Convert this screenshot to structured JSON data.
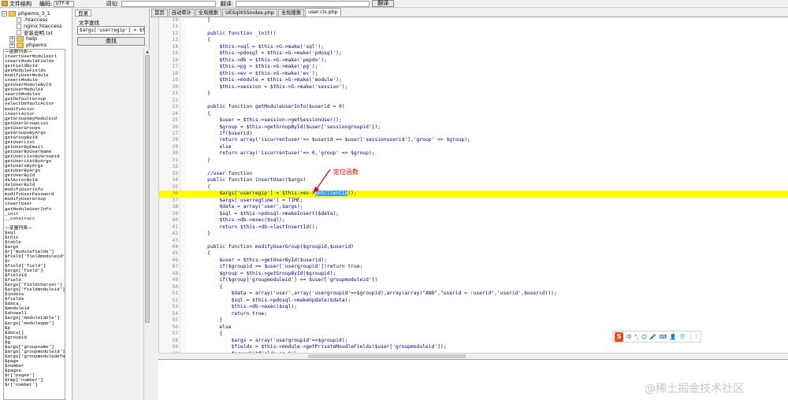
{
  "toolbar": {
    "structure_label": "文件结构",
    "encoding_label": "编码:",
    "encoding_value": "UTF-8",
    "word_label": "词句:",
    "translate_label": "翻译:",
    "translate_button": "翻译"
  },
  "file_tree": {
    "items": [
      {
        "label": "phpems_3_1",
        "level": 0,
        "type": "folder"
      },
      {
        "label": ".htaccess",
        "level": 1,
        "type": "file"
      },
      {
        "label": "nginx.htaccess",
        "level": 1,
        "type": "file"
      },
      {
        "label": "安装说明.txt",
        "level": 1,
        "type": "file"
      },
      {
        "label": "help",
        "level": 1,
        "type": "folder"
      },
      {
        "label": "phpems",
        "level": 1,
        "type": "folder"
      },
      {
        "label": "plugin",
        "level": 1,
        "type": "folder"
      }
    ]
  },
  "finder": {
    "tab_label": "目录",
    "title": "文字查找",
    "search_value": "$args['userregip'] = $this->ev->getClientIp();",
    "search_button": "查找",
    "function_list_title": "—函数列表—",
    "functions": [
      "insertUserModuleUrl",
      "insertModuleFields",
      "getFieldById",
      "getModuleFields",
      "modifyUserModule",
      "insertModule",
      "getUserModuleById",
      "getUserModules",
      "searchModules",
      "getDefaultGroup",
      "selectDefaultActor",
      "modifyActor",
      "insertActor",
      "getGroupsByModuleid",
      "getUserGroupList",
      "getUserGroups",
      "getGroupsByArgs",
      "getGroupById",
      "getUserList",
      "getUserByEmail",
      "getUserByUserName",
      "getUserListByGroupid",
      "getUserListByArgs",
      "getUsersByArgs",
      "getUserByArgs",
      "getUserById",
      "delActorById",
      "delUserById",
      "modifyUserInfo",
      "modifyUserPassword",
      "modifyUserGroup",
      "insertUser",
      "getModuleUserInfo",
      "_init",
      "__construct"
    ],
    "variable_list_title": "—变量列表—",
    "variables": [
      "$sql",
      "$this",
      "$table",
      "$args",
      "$r['modulefields']",
      "$field['fieldmoduleid']",
      "$r",
      "$field['field']",
      "$args['field']",
      "$fieldid",
      "$field",
      "$args['fieldcharset']",
      "$args['fieldmoduleid']",
      "$indexs",
      "$fields",
      "$data",
      "$moduleid",
      "$showall",
      "$args['moduletable']",
      "$args['moduleapp']",
      "$p",
      "$data[]",
      "$groupid",
      "$g",
      "$args['groupname']",
      "$args['groupmoduleid']",
      "$args['groupmoduledefault']",
      "$page",
      "$number",
      "$pages",
      "$r['pages']",
      "$tmp['number']",
      "$r['number']"
    ]
  },
  "editor": {
    "tabs": [
      "首页",
      "自动审计",
      "全局搜索",
      "UESqlXSSindex.php",
      "全局搜索",
      "user.cls.php"
    ],
    "active_tab": 5,
    "highlight_line": 36,
    "selected_text": "getClientIp",
    "lines": [
      {
        "n": "10",
        "t": "    }"
      },
      {
        "n": "11",
        "t": ""
      },
      {
        "n": "12",
        "t": "    public function _init()"
      },
      {
        "n": "13",
        "t": "    {"
      },
      {
        "n": "14",
        "t": "        $this->sql = $this->G->make('sql');"
      },
      {
        "n": "15",
        "t": "        $this->pdosql = $this->G->make('pdosql');"
      },
      {
        "n": "16",
        "t": "        $this->db = $this->G->make('pepdo');"
      },
      {
        "n": "17",
        "t": "        $this->pg = $this->G->make('pg');"
      },
      {
        "n": "18",
        "t": "        $this->ev = $this->G->make('ev');"
      },
      {
        "n": "19",
        "t": "        $this->module = $this->G->make('module');"
      },
      {
        "n": "20",
        "t": "        $this->session = $this->G->make('session');"
      },
      {
        "n": "21",
        "t": "    }"
      },
      {
        "n": "22",
        "t": ""
      },
      {
        "n": "23",
        "t": "    public function getModuleUserInfo($userid = 0)"
      },
      {
        "n": "24",
        "t": "    {"
      },
      {
        "n": "25",
        "t": "        $user = $this->session->getSessionUser();"
      },
      {
        "n": "26",
        "t": "        $group = $this->getGroupById($user['sessiongroupid']);"
      },
      {
        "n": "27",
        "t": "        if($userid)"
      },
      {
        "n": "28",
        "t": "        return array('iscurrentuser'=> $userid == $user['sessionuserid'],'group' => $group);"
      },
      {
        "n": "29",
        "t": "        else"
      },
      {
        "n": "30",
        "t": "        return array('iscurrentuser'=> 0,'group' => $group);"
      },
      {
        "n": "31",
        "t": "    }"
      },
      {
        "n": "32",
        "t": ""
      },
      {
        "n": "33",
        "t": "    //user function"
      },
      {
        "n": "34",
        "t": "    public function insertUser($args)"
      },
      {
        "n": "35",
        "t": "    {"
      },
      {
        "n": "36",
        "t": "        $args['userregip'] = $this->ev->getClientIp();"
      },
      {
        "n": "37",
        "t": "        $args['userregtime'] = TIME;"
      },
      {
        "n": "38",
        "t": "        $data = array('user',$args);"
      },
      {
        "n": "39",
        "t": "        $sql = $this->pdosql->makeInsert($data);"
      },
      {
        "n": "40",
        "t": "        $this->db->exec($sql);"
      },
      {
        "n": "41",
        "t": "        return $this->db->lastInsertId();"
      },
      {
        "n": "42",
        "t": "    }"
      },
      {
        "n": "43",
        "t": ""
      },
      {
        "n": "44",
        "t": "    public function modifyUserGroup($groupid,$userid)"
      },
      {
        "n": "45",
        "t": "    {"
      },
      {
        "n": "46",
        "t": "        $user = $this->getUserById($userid);"
      },
      {
        "n": "47",
        "t": "        if($groupid == $user['usergroupid'])return true;"
      },
      {
        "n": "48",
        "t": "        $group = $this->getGroupById($groupid);"
      },
      {
        "n": "49",
        "t": "        if($group['groupmoduleid'] == $user['groupmoduleid'])"
      },
      {
        "n": "50",
        "t": "        {"
      },
      {
        "n": "51",
        "t": "            $data = array('user',array('usergroupid'=>$groupid),array(array(\"AND\",\"userid = :userid\",'userid',$userid)));"
      },
      {
        "n": "52",
        "t": "            $sql = $this->pdosql->makeUpdate($data);"
      },
      {
        "n": "53",
        "t": "            $this->db->exec($sql);"
      },
      {
        "n": "54",
        "t": "            return true;"
      },
      {
        "n": "55",
        "t": "        }"
      },
      {
        "n": "56",
        "t": "        else"
      },
      {
        "n": "57",
        "t": "        {"
      },
      {
        "n": "58",
        "t": "            $args = array('usergroupid'=>$groupid);"
      },
      {
        "n": "59",
        "t": "            $fields = $this->module->getPrivateMoudleFields($user['groupmoduleid']);"
      },
      {
        "n": "60",
        "t": "            foreach($fields as $v)"
      }
    ]
  },
  "annotation": {
    "text": "定位函数",
    "color": "#e00000"
  },
  "ime": {
    "logo": "S",
    "symbols": [
      "中",
      "°,",
      "☺",
      "🎤",
      "⌨",
      "👤",
      "👕",
      "⋮⋮"
    ]
  },
  "watermark": "@稀土掘金技术社区",
  "colors": {
    "highlight": "#ffff00",
    "selection": "#3399ff",
    "code": "#000080"
  }
}
